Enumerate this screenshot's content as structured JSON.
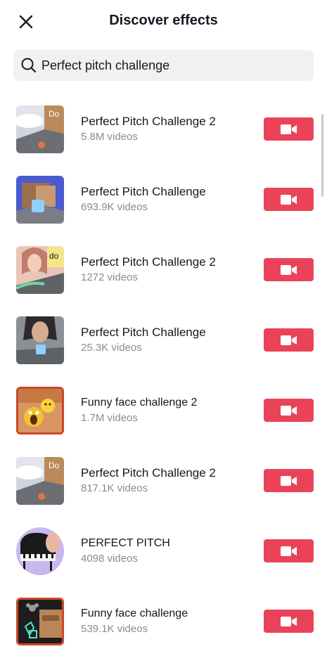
{
  "header": {
    "title": "Discover effects",
    "close_icon": "close-icon"
  },
  "search": {
    "value": "Perfect pitch challenge",
    "icon": "search-icon"
  },
  "colors": {
    "accent": "#ea4359",
    "secondary_text": "#8a8b91",
    "search_bg": "#f1f1f2"
  },
  "effects": [
    {
      "name": "Perfect Pitch Challenge 2",
      "count": "5.8M videos",
      "thumb_label": "Do"
    },
    {
      "name": "Perfect Pitch Challenge",
      "count": "693.9K videos"
    },
    {
      "name": "Perfect Pitch Challenge 2",
      "count": "1272 videos",
      "thumb_label": "do"
    },
    {
      "name": "Perfect Pitch Challenge",
      "count": "25.3K videos"
    },
    {
      "name": "Funny face challenge 2",
      "count": "1.7M videos"
    },
    {
      "name": "Perfect Pitch Challenge 2",
      "count": "817.1K videos",
      "thumb_label": "Do"
    },
    {
      "name": "PERFECT PITCH",
      "count": "4098 videos"
    },
    {
      "name": "Funny face challenge",
      "count": "539.1K videos"
    }
  ],
  "record_icon": "video-camera-icon"
}
